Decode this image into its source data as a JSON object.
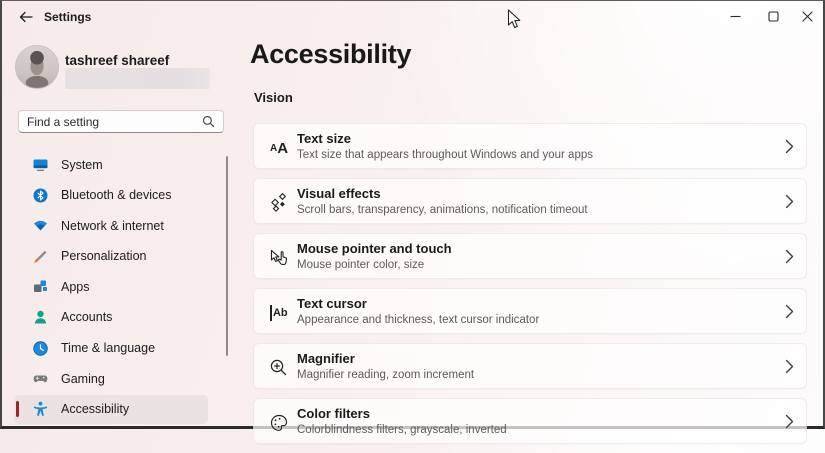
{
  "titlebar": {
    "title": "Settings"
  },
  "profile": {
    "name": "tashreef shareef"
  },
  "search": {
    "placeholder": "Find a setting"
  },
  "sidebar": {
    "items": [
      {
        "label": "System",
        "icon": "system-icon"
      },
      {
        "label": "Bluetooth & devices",
        "icon": "bluetooth-icon"
      },
      {
        "label": "Network & internet",
        "icon": "network-icon"
      },
      {
        "label": "Personalization",
        "icon": "personalization-icon"
      },
      {
        "label": "Apps",
        "icon": "apps-icon"
      },
      {
        "label": "Accounts",
        "icon": "accounts-icon"
      },
      {
        "label": "Time & language",
        "icon": "time-language-icon"
      },
      {
        "label": "Gaming",
        "icon": "gaming-icon"
      },
      {
        "label": "Accessibility",
        "icon": "accessibility-icon",
        "selected": true
      }
    ]
  },
  "main": {
    "title": "Accessibility",
    "section_label": "Vision",
    "cards": [
      {
        "title": "Text size",
        "subtitle": "Text size that appears throughout Windows and your apps",
        "icon": "text-size-icon",
        "glyph_small": "A",
        "glyph_large": "A"
      },
      {
        "title": "Visual effects",
        "subtitle": "Scroll bars, transparency, animations, notification timeout",
        "icon": "visual-effects-icon"
      },
      {
        "title": "Mouse pointer and touch",
        "subtitle": "Mouse pointer color, size",
        "icon": "mouse-pointer-touch-icon"
      },
      {
        "title": "Text cursor",
        "subtitle": "Appearance and thickness, text cursor indicator",
        "icon": "text-cursor-icon",
        "glyph": "Ab"
      },
      {
        "title": "Magnifier",
        "subtitle": "Magnifier reading, zoom increment",
        "icon": "magnifier-icon"
      },
      {
        "title": "Color filters",
        "subtitle": "Colorblindness filters, grayscale, inverted",
        "icon": "color-filters-icon"
      }
    ]
  },
  "colors": {
    "accent_bar": "#932a2a",
    "windows_blue": "#0b76d1",
    "accounts_teal": "#13a18c",
    "brush_orange": "#e8762c",
    "background_tint": "#f6ebe9"
  }
}
